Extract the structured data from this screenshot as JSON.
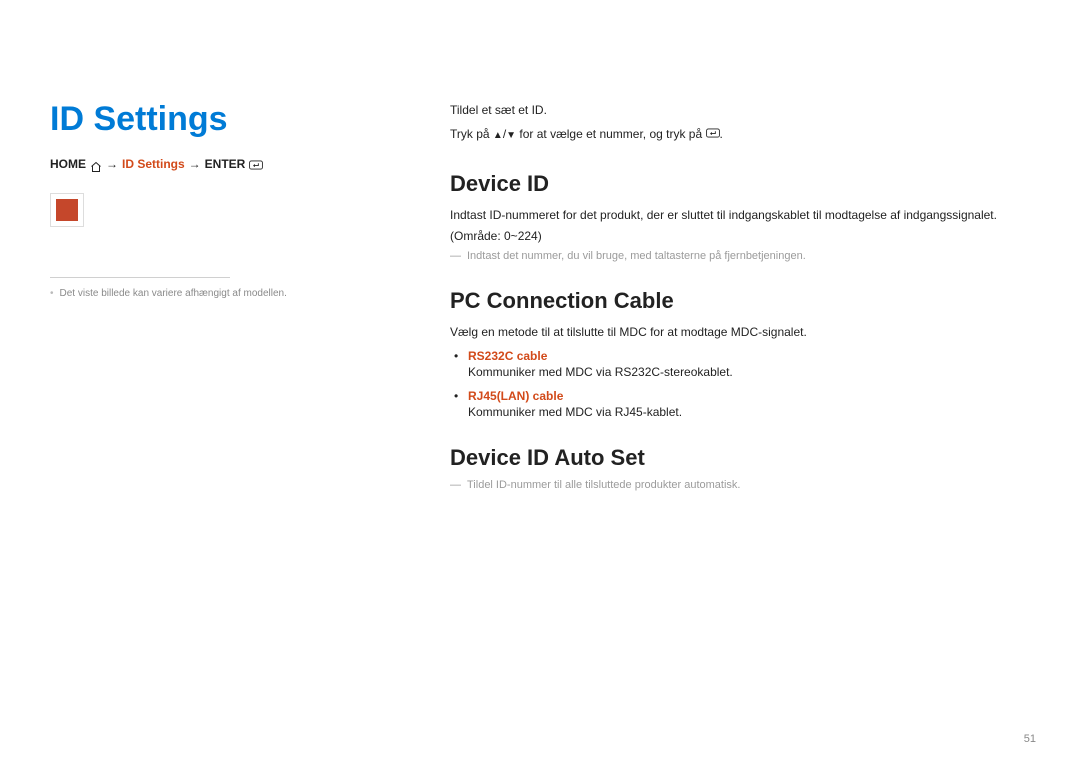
{
  "title": "ID Settings",
  "breadcrumb": {
    "home": "HOME",
    "arrow": "→",
    "mid": "ID Settings",
    "enter": "ENTER"
  },
  "left": {
    "footnote": "Det viste billede kan variere afhængigt af modellen."
  },
  "intro": {
    "line1": "Tildel et sæt et ID.",
    "line2a": "Tryk på",
    "line2b": "for at vælge et nummer, og tryk på",
    "line2c": "."
  },
  "sections": {
    "deviceId": {
      "heading": "Device ID",
      "body": "Indtast ID-nummeret for det produkt, der er sluttet til indgangskablet til modtagelse af indgangssignalet. (Område: 0~224)",
      "note": "Indtast det nummer, du vil bruge, med taltasterne på fjernbetjeningen."
    },
    "pcConn": {
      "heading": "PC Connection Cable",
      "body": "Vælg en metode til at tilslutte til MDC for at modtage MDC-signalet.",
      "opts": [
        {
          "title": "RS232C cable",
          "desc": "Kommuniker med MDC via RS232C-stereokablet."
        },
        {
          "title": "RJ45(LAN) cable",
          "desc": "Kommuniker med MDC via RJ45-kablet."
        }
      ]
    },
    "autoSet": {
      "heading": "Device ID Auto Set",
      "note": "Tildel ID-nummer til alle tilsluttede produkter automatisk."
    }
  },
  "pageNum": "51"
}
